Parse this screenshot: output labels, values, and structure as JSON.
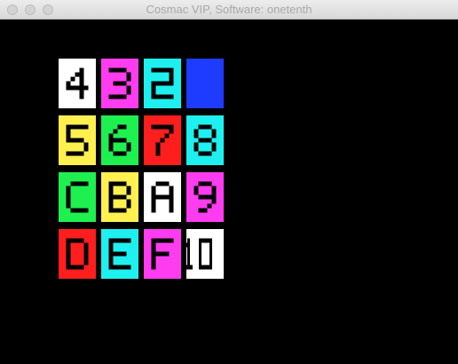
{
  "window": {
    "title": "Cosmac VIP, Software: onetenth"
  },
  "buttons": {
    "close": "close",
    "minimize": "minimize",
    "maximize": "maximize"
  },
  "tiles": [
    {
      "label": "4",
      "bg": "#ffffff",
      "fg": "#000000"
    },
    {
      "label": "3",
      "bg": "#ff3cf0",
      "fg": "#000000"
    },
    {
      "label": "2",
      "bg": "#1ef0f0",
      "fg": "#000000"
    },
    {
      "label": "",
      "bg": "#1e3cff",
      "fg": "#1e3cff"
    },
    {
      "label": "5",
      "bg": "#fff050",
      "fg": "#000000"
    },
    {
      "label": "6",
      "bg": "#1ef050",
      "fg": "#000000"
    },
    {
      "label": "7",
      "bg": "#ff1e1e",
      "fg": "#000000"
    },
    {
      "label": "8",
      "bg": "#1ef0f0",
      "fg": "#000000"
    },
    {
      "label": "C",
      "bg": "#1ef050",
      "fg": "#000000"
    },
    {
      "label": "B",
      "bg": "#fff050",
      "fg": "#000000"
    },
    {
      "label": "A",
      "bg": "#ffffff",
      "fg": "#000000"
    },
    {
      "label": "9",
      "bg": "#ff3cf0",
      "fg": "#000000"
    },
    {
      "label": "D",
      "bg": "#ff1e1e",
      "fg": "#000000"
    },
    {
      "label": "E",
      "bg": "#1ef0f0",
      "fg": "#000000"
    },
    {
      "label": "F",
      "bg": "#ff3cf0",
      "fg": "#000000"
    },
    {
      "label": "10",
      "bg": "#ffffff",
      "fg": "#000000"
    }
  ]
}
